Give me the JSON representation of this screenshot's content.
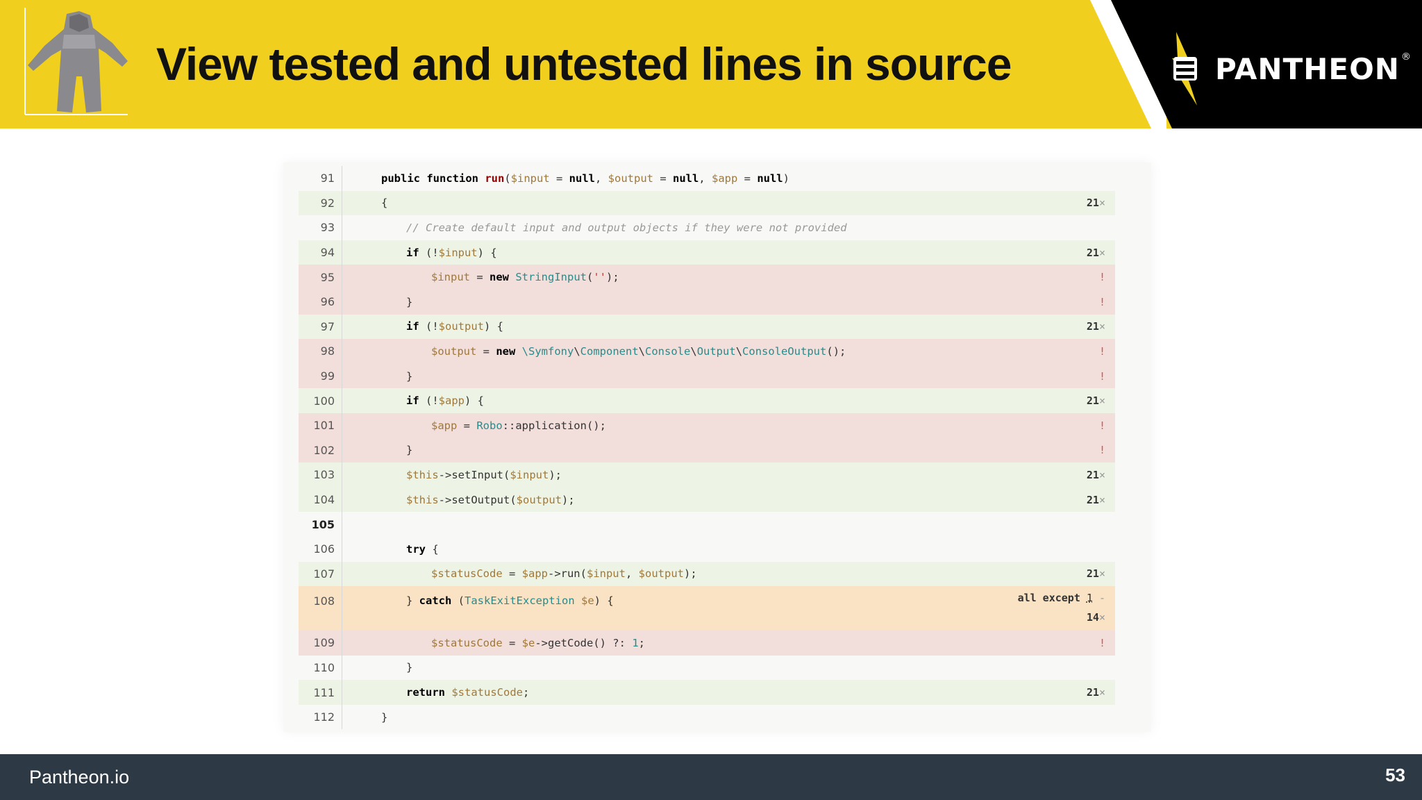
{
  "header": {
    "title": "View tested and untested lines in source",
    "logo_text": "PANTHEON",
    "logo_reg": "®",
    "mascot_icon": "astronaut-suit-icon",
    "logo_icon": "pantheon-fist-bolt-icon"
  },
  "colors": {
    "header_yellow": "#f0cf1e",
    "tested_bg": "#eef4e5",
    "untested_bg": "#f2dfdb",
    "partial_bg": "#fae2c4",
    "footer_bg": "#2d3a45"
  },
  "code": {
    "rows": [
      {
        "line": "91"
      },
      {
        "line": "92",
        "hits": "21",
        "times": "×"
      },
      {
        "line": "93",
        "comment": "// Create default input and output objects if they were not provided"
      },
      {
        "line": "94",
        "hits": "21",
        "times": "×"
      },
      {
        "line": "95",
        "miss": "!"
      },
      {
        "line": "96",
        "miss": "!"
      },
      {
        "line": "97",
        "hits": "21",
        "times": "×"
      },
      {
        "line": "98",
        "miss": "!"
      },
      {
        "line": "99",
        "miss": "!"
      },
      {
        "line": "100",
        "hits": "21",
        "times": "×"
      },
      {
        "line": "101",
        "miss": "!"
      },
      {
        "line": "102",
        "miss": "!"
      },
      {
        "line": "103",
        "hits": "21",
        "times": "×"
      },
      {
        "line": "104",
        "hits": "21",
        "times": "×"
      },
      {
        "line": "105"
      },
      {
        "line": "106"
      },
      {
        "line": "107",
        "hits": "21",
        "times": "×"
      },
      {
        "line": "108",
        "partial_label": "all except",
        "partial_count": "1",
        "partial_suffix": "-",
        "hits": "14",
        "times": "×"
      },
      {
        "line": "109",
        "miss": "!"
      },
      {
        "line": "110"
      },
      {
        "line": "111",
        "hits": "21",
        "times": "×"
      },
      {
        "line": "112"
      }
    ]
  },
  "footer": {
    "site": "Pantheon.io",
    "page_number": "53"
  }
}
